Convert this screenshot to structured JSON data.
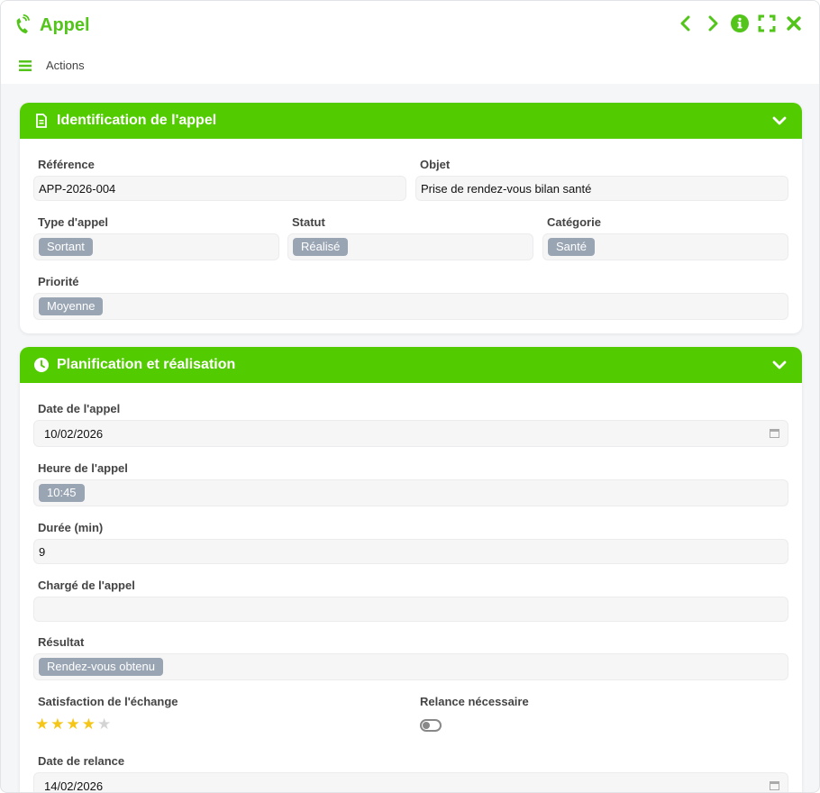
{
  "app": {
    "title": "Appel",
    "accent": "#52cc00",
    "toolbar": {
      "actions_label": "Actions"
    },
    "controls": [
      "chevron-left-icon",
      "chevron-right-icon",
      "info-icon",
      "expand-icon",
      "close-icon"
    ]
  },
  "section1": {
    "title": "Identification de l'appel",
    "reference": {
      "label": "Référence",
      "value": "APP-2026-004"
    },
    "objet": {
      "label": "Objet",
      "value": "Prise de rendez-vous bilan santé"
    },
    "type": {
      "label": "Type d'appel",
      "value": "Sortant"
    },
    "statut": {
      "label": "Statut",
      "value": "Réalisé"
    },
    "categorie": {
      "label": "Catégorie",
      "value": "Santé"
    },
    "priorite": {
      "label": "Priorité",
      "value": "Moyenne"
    }
  },
  "section2": {
    "title": "Planification et réalisation",
    "date": {
      "label": "Date de l'appel",
      "value": "10/02/2026"
    },
    "heure": {
      "label": "Heure de l'appel",
      "value": "10:45"
    },
    "duree": {
      "label": "Durée (min)",
      "value": "9"
    },
    "charge": {
      "label": "Chargé de l'appel",
      "value": ""
    },
    "resultat": {
      "label": "Résultat",
      "value": "Rendez-vous obtenu"
    },
    "satisfaction": {
      "label": "Satisfaction de l'échange",
      "rating": 4,
      "max": 5
    },
    "relance": {
      "label": "Relance nécessaire",
      "value": false
    },
    "date_relance": {
      "label": "Date de relance",
      "value": "14/02/2026"
    }
  }
}
